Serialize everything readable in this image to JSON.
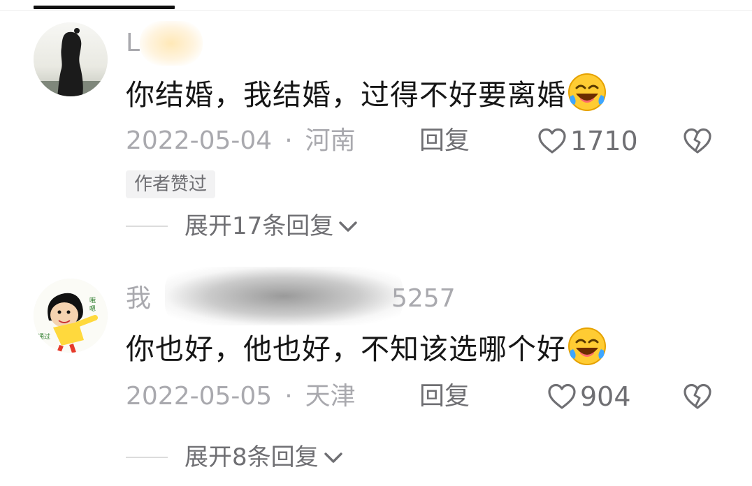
{
  "comments": [
    {
      "username": "L",
      "content": "你结婚，我结婚，过得不好要离婚",
      "emoji": "laughing-crying-emoji",
      "date": "2022-05-04",
      "separator": "·",
      "location": "河南",
      "reply_label": "回复",
      "likes": "1710",
      "badge": "作者赞过",
      "expand_label": "展开17条回复"
    },
    {
      "username": "我",
      "username_suffix": "5257",
      "content": "你也好，他也好，不知该选哪个好",
      "emoji": "laughing-crying-emoji",
      "date": "2022-05-05",
      "separator": "·",
      "location": "天津",
      "reply_label": "回复",
      "likes": "904",
      "expand_label": "展开8条回复"
    }
  ],
  "colors": {
    "text_primary": "#161616",
    "text_secondary": "#a9a9ae",
    "text_action": "#6f6f73",
    "badge_bg": "#f2f2f3",
    "tab_indicator": "#111111"
  },
  "icons": [
    "heart-outline-icon",
    "broken-heart-icon",
    "chevron-down-icon"
  ]
}
